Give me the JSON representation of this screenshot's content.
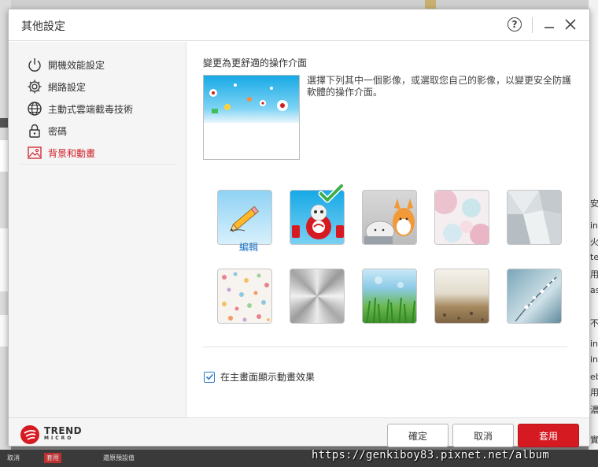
{
  "window": {
    "title": "其他設定",
    "help_glyph": "?"
  },
  "sidebar": {
    "items": [
      {
        "label": "開機效能設定",
        "icon": "power-icon"
      },
      {
        "label": "網路設定",
        "icon": "gear-icon"
      },
      {
        "label": "主動式雲端截毒技術",
        "icon": "globe-icon"
      },
      {
        "label": "密碼",
        "icon": "lock-icon"
      },
      {
        "label": "背景和動畫",
        "icon": "image-icon",
        "active": true
      }
    ]
  },
  "main": {
    "heading": "變更為更舒適的操作介面",
    "description": "選擇下列其中一個影像，或選取您自己的影像，以變更安全防護軟體的操作介面。",
    "edit_label": "編輯",
    "animation_checkbox": {
      "label": "在主畫面顯示動畫效果",
      "checked": true
    },
    "themes": [
      "edit-pencil",
      "trend-mascot",
      "fox-cat",
      "pastel-circles",
      "grey-geometric",
      "polka-dots",
      "radial-metal",
      "green-grass",
      "sand-beach",
      "blue-blossom"
    ],
    "selected_theme": "trend-mascot"
  },
  "footer": {
    "logo_line1": "TREND",
    "logo_line2": "MICRO",
    "ok_label": "確定",
    "cancel_label": "取消",
    "apply_label": "套用"
  },
  "background": {
    "taskbar_items": [
      "取消",
      "套用",
      "還原預設值"
    ],
    "right_glyphs": [
      "安",
      "in",
      "火",
      "te",
      "用",
      "as",
      "不",
      "in",
      "in",
      "eb",
      "用",
      "濃",
      "實"
    ]
  },
  "watermark": "https://genkiboy83.pixnet.net/album",
  "colors": {
    "accent": "#d61a21",
    "link": "#1a73c8",
    "checkbox": "#2b78c5"
  }
}
